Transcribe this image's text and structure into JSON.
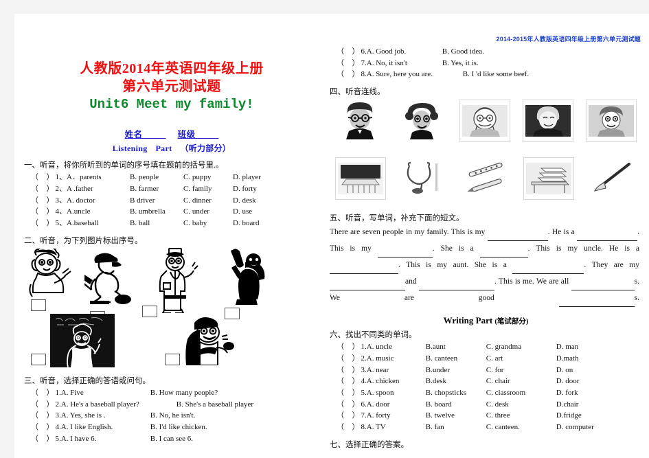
{
  "header": {
    "running_title": "2014-2015年人教版英语四年级上册第六单元测试题"
  },
  "title": {
    "line1": "人教版2014年英语四年级上册",
    "line2": "第六单元测试题",
    "unit": "Unit6 Meet my family!",
    "color_red": "#ee1111",
    "color_green": "#0a8a2a",
    "color_blue": "#1b1bd0"
  },
  "info_line": {
    "name_label": "姓名",
    "class_label": "班级",
    "blank": "_____"
  },
  "listening_part": {
    "en": "Listening",
    "part": "Part",
    "cn": "（听力部分）"
  },
  "writing_part": {
    "en": "Writing Part",
    "cn": "(笔试部分)"
  },
  "sections": {
    "s1": {
      "heading": "一、听音，将你所听到的单词的序号填在题前的括号里.。",
      "items": [
        {
          "num": "1、",
          "a": "A．parents",
          "b": "B. people",
          "c": "C. puppy",
          "d": "D. player"
        },
        {
          "num": "2、",
          "a": "A .father",
          "b": "B. farmer",
          "c": "C. family",
          "d": "D. forty"
        },
        {
          "num": "3、",
          "a": "A. doctor",
          "b": "B driver",
          "c": "C. dinner",
          "d": "D. desk"
        },
        {
          "num": "4、",
          "a": "A.uncle",
          "b": "B. umbrella",
          "c": "C. under",
          "d": "D. use"
        },
        {
          "num": "5、",
          "a": "A.baseball",
          "b": "B. ball",
          "c": "C. baby",
          "d": "D. board"
        }
      ]
    },
    "s2": {
      "heading": "二、听音，为下列图片标出序号。",
      "pictures": [
        {
          "name": "girl-with-pencil",
          "box": ""
        },
        {
          "name": "baseball-batter",
          "box": ""
        },
        {
          "name": "doctor",
          "box": ""
        },
        {
          "name": "baseball-silhouette",
          "box": ""
        },
        {
          "name": "teacher-at-blackboard",
          "box": ""
        },
        {
          "name": "boy-with-food",
          "box": ""
        }
      ]
    },
    "s3": {
      "heading": "三、听音，选择正确的答语或问句。",
      "items": [
        {
          "num": "1.",
          "a": "A. Five",
          "b": "B. How many people?"
        },
        {
          "num": "2.",
          "a": "A. He's a baseball player?",
          "b": "B. She's a baseball player"
        },
        {
          "num": "3.",
          "a": "A. Yes, she is .",
          "b": "B. No, he isn't."
        },
        {
          "num": "4.",
          "a": "A. I like English.",
          "b": "B. I'd like chicken."
        },
        {
          "num": "5.",
          "a": "A. I have 6.",
          "b": "B. I can see 6."
        },
        {
          "num": "6.",
          "a": "A. Good job.",
          "b": "B. Good idea."
        },
        {
          "num": "7.",
          "a": "A. No, it isn't",
          "b": "B. Yes, it is."
        },
        {
          "num": "8.",
          "a": "A. Sure, here you are.",
          "b": "B. I 'd like some beef."
        }
      ]
    },
    "s4": {
      "heading": "四、听音连线。",
      "row1": [
        "father-with-glasses",
        "mother",
        "grandpa",
        "grandma",
        "boy"
      ],
      "row2": [
        "desk-blackboard",
        "stethoscope",
        "flute-pen",
        "books-on-desk",
        "hockey-stick"
      ]
    },
    "s5": {
      "heading": "五、听音，写单词，补充下面的短文。",
      "passage_parts": [
        "There are seven people in my family. This is my",
        ". He is a",
        ". This is my",
        ". She is a",
        ". This is my uncle. He is a",
        ". This is my aunt. She is a",
        ". They are my",
        "and",
        ". This is me. We are all",
        "s. We are good",
        "s."
      ]
    },
    "s6": {
      "heading": "六、找出不同类的单词。",
      "items": [
        {
          "num": "1.",
          "a": "A. uncle",
          "b": "B.aunt",
          "c": "C. grandma",
          "d": "D. man"
        },
        {
          "num": "2.",
          "a": "A. music",
          "b": "B. canteen",
          "c": "C. art",
          "d": "D.math"
        },
        {
          "num": "3.",
          "a": "A. near",
          "b": "B.under",
          "c": "C. for",
          "d": "D. on"
        },
        {
          "num": "4.",
          "a": "A. chicken",
          "b": "B.desk",
          "c": "C. chair",
          "d": "D. door"
        },
        {
          "num": "5.",
          "a": "A. spoon",
          "b": "B. chopsticks",
          "c": "C. classroom",
          "d": "D. fork"
        },
        {
          "num": "6.",
          "a": "A. door",
          "b": "B. board",
          "c": "C. desk",
          "d": "D.chair"
        },
        {
          "num": "7.",
          "a": "A. forty",
          "b": "B. twelve",
          "c": "C. three",
          "d": "D.fridge"
        },
        {
          "num": "8.",
          "a": "A. TV",
          "b": "B. fan",
          "c": "C. canteen.",
          "d": "D. computer"
        }
      ]
    },
    "s7": {
      "heading": "七、选择正确的答案。"
    }
  }
}
